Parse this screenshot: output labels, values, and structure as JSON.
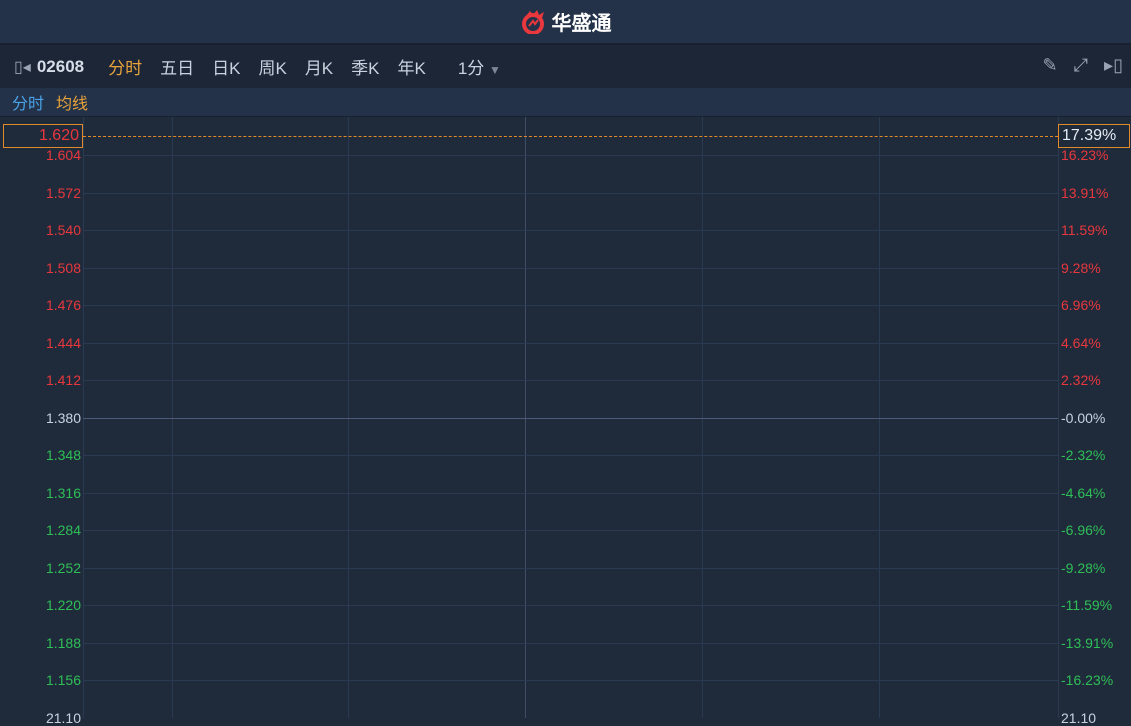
{
  "app": {
    "title": "华盛通"
  },
  "toolbar": {
    "code": "02608",
    "tabs": [
      "分时",
      "五日",
      "日K",
      "周K",
      "月K",
      "季K",
      "年K"
    ],
    "active_tab": "分时",
    "interval": "1分"
  },
  "subbar": {
    "label1": "分时",
    "label2": "均线"
  },
  "chart": {
    "price_levels": [
      "1.604",
      "1.572",
      "1.540",
      "1.508",
      "1.476",
      "1.444",
      "1.412",
      "1.380",
      "1.348",
      "1.316",
      "1.284",
      "1.252",
      "1.220",
      "1.188",
      "1.156"
    ],
    "pct_levels": [
      "16.23%",
      "13.91%",
      "11.59%",
      "9.28%",
      "6.96%",
      "4.64%",
      "2.32%",
      "-0.00%",
      "-2.32%",
      "-4.64%",
      "-6.96%",
      "-9.28%",
      "-11.59%",
      "-13.91%",
      "-16.23%"
    ],
    "cursor_price": "1.620",
    "cursor_pct": "17.39%",
    "bottom_left": "21.10",
    "bottom_right": "21.10",
    "colors": {
      "up": "#e8383d",
      "down": "#2fbf57",
      "accent": "#e8a33a"
    }
  }
}
